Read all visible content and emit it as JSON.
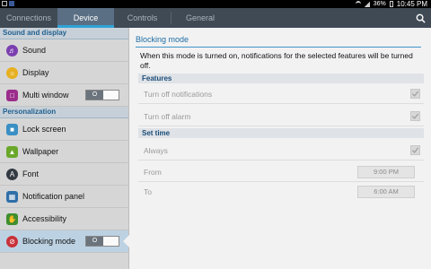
{
  "status_bar": {
    "battery": "36%",
    "time": "10:45 PM"
  },
  "tabs": [
    {
      "label": "Connections",
      "active": false
    },
    {
      "label": "Device",
      "active": true
    },
    {
      "label": "Controls",
      "active": false
    },
    {
      "label": "General",
      "active": false
    }
  ],
  "sidebar": {
    "sections": [
      {
        "title": "Sound and display",
        "items": [
          {
            "label": "Sound",
            "icon": "sound-icon",
            "color": "#7b3fb0"
          },
          {
            "label": "Display",
            "icon": "display-icon",
            "color": "#e6b020"
          },
          {
            "label": "Multi window",
            "icon": "multi-window-icon",
            "color": "#9c2d8c",
            "toggle": "O"
          }
        ]
      },
      {
        "title": "Personalization",
        "items": [
          {
            "label": "Lock screen",
            "icon": "lock-icon",
            "color": "#3a8fc4"
          },
          {
            "label": "Wallpaper",
            "icon": "wallpaper-icon",
            "color": "#6aa82a"
          },
          {
            "label": "Font",
            "icon": "font-icon",
            "color": "#333a44",
            "glyph": "A"
          },
          {
            "label": "Notification panel",
            "icon": "notification-panel-icon",
            "color": "#2f6fa8"
          },
          {
            "label": "Accessibility",
            "icon": "accessibility-icon",
            "color": "#3e8e2e"
          },
          {
            "label": "Blocking mode",
            "icon": "blocking-mode-icon",
            "color": "#c8323a",
            "toggle": "O",
            "active": true
          }
        ]
      }
    ]
  },
  "main": {
    "title": "Blocking mode",
    "description": "When this mode is turned on, notifications for the selected features will be turned off.",
    "features_header": "Features",
    "features": [
      {
        "label": "Turn off notifications",
        "checked": true
      },
      {
        "label": "Turn off alarm",
        "checked": true
      }
    ],
    "set_time_header": "Set time",
    "always": {
      "label": "Always",
      "checked": true
    },
    "from": {
      "label": "From",
      "value": "9:00 PM"
    },
    "to": {
      "label": "To",
      "value": "6:00 AM"
    }
  },
  "colors": {
    "accent": "#2ea3d8",
    "tab_bar": "#3f4a55",
    "title_blue": "#1e6ea7"
  }
}
